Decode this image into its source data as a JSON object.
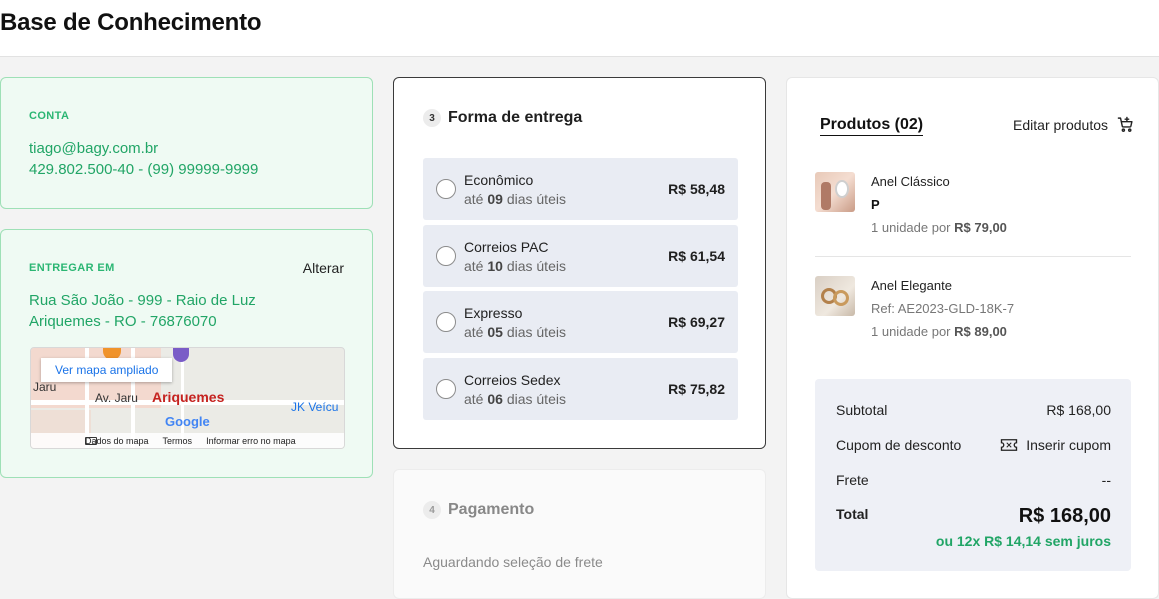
{
  "header": {
    "title": "Base de Conhecimento"
  },
  "account": {
    "label": "CONTA",
    "email": "tiago@bagy.com.br",
    "details": "429.802.500-40 - (99) 99999-9999"
  },
  "shipping_address": {
    "label": "ENTREGAR EM",
    "change_label": "Alterar",
    "line1": "Rua São João - 999 - Raio de Luz",
    "line2": "Ariquemes - RO - 76876070",
    "map": {
      "enlarge_label": "Ver mapa ampliado",
      "city_label": "Ariquemes",
      "street_label": "Av. Jaru",
      "street2_label": "Jaru",
      "place_label": "JK Veícu",
      "footer_data": "Dados do mapa",
      "footer_terms": "Termos",
      "footer_report": "Informar erro no mapa",
      "google": "Google"
    }
  },
  "delivery": {
    "step": "3",
    "title": "Forma de entrega",
    "options": [
      {
        "name": "Econômico",
        "prefix": "até",
        "days": "09",
        "suffix": "dias úteis",
        "price": "R$ 58,48"
      },
      {
        "name": "Correios PAC",
        "prefix": "até",
        "days": "10",
        "suffix": "dias úteis",
        "price": "R$ 61,54"
      },
      {
        "name": "Expresso",
        "prefix": "até",
        "days": "05",
        "suffix": "dias úteis",
        "price": "R$ 69,27"
      },
      {
        "name": "Correios Sedex",
        "prefix": "até",
        "days": "06",
        "suffix": "dias úteis",
        "price": "R$ 75,82"
      }
    ]
  },
  "payment": {
    "step": "4",
    "title": "Pagamento",
    "status": "Aguardando seleção de frete"
  },
  "summary": {
    "products_title": "Produtos (02)",
    "edit_label": "Editar produtos",
    "products": [
      {
        "name": "Anel Clássico",
        "variant": "P",
        "qty_text": "1 unidade por",
        "price": "R$ 79,00"
      },
      {
        "name": "Anel Elegante",
        "ref": "Ref: AE2023-GLD-18K-7",
        "qty_text": "1 unidade por",
        "price": "R$ 89,00"
      }
    ],
    "subtotal_label": "Subtotal",
    "subtotal_value": "R$ 168,00",
    "coupon_label": "Cupom de desconto",
    "coupon_action": "Inserir cupom",
    "shipping_label": "Frete",
    "shipping_value": "--",
    "total_label": "Total",
    "total_value": "R$ 168,00",
    "installments": "ou 12x R$ 14,14 sem juros"
  },
  "colors": {
    "accent_green": "#21a566",
    "card_green_bg": "#effaf3",
    "option_bg": "#e9ecf3"
  },
  "icons": {
    "cart": "cart-plus-icon",
    "coupon": "ticket-icon",
    "radio": "radio-unchecked-icon"
  }
}
